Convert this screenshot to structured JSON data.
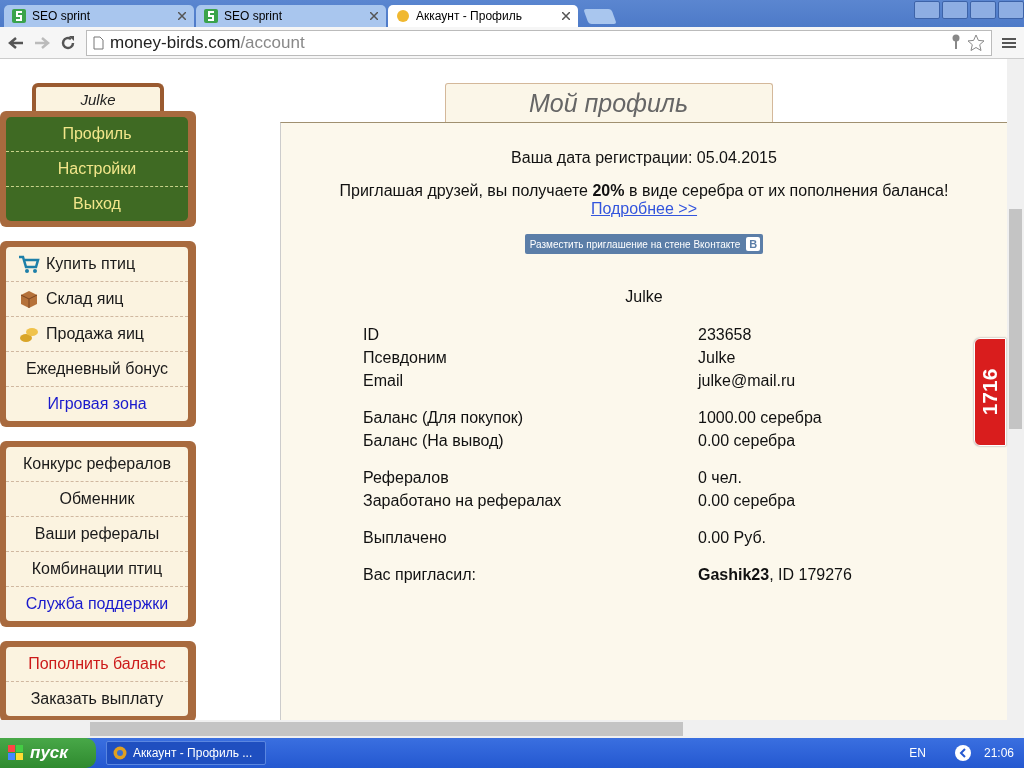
{
  "browser": {
    "tabs": [
      {
        "title": "SEO sprint",
        "selected": false,
        "kind": "seo"
      },
      {
        "title": "SEO sprint",
        "selected": false,
        "kind": "seo"
      },
      {
        "title": "Аккаунт - Профиль",
        "selected": true,
        "kind": "bird"
      }
    ],
    "address": {
      "host": "money-birds.com",
      "path": "/account"
    }
  },
  "sidebar": {
    "user": "Julke",
    "user_menu": [
      {
        "label": "Профиль"
      },
      {
        "label": "Настройки"
      },
      {
        "label": "Выход"
      }
    ],
    "groups": [
      [
        {
          "label": "Купить птиц",
          "kind": "cart",
          "color": "#1a1a1a"
        },
        {
          "label": "Склад яиц",
          "kind": "box",
          "color": "#1a1a1a"
        },
        {
          "label": "Продажа яиц",
          "kind": "coins",
          "color": "#1a1a1a"
        },
        {
          "label": "Ежедневный бонус",
          "color": "#1a1a1a"
        },
        {
          "label": "Игровая зона",
          "color": "#1a1acc"
        }
      ],
      [
        {
          "label": "Конкурс рефералов",
          "color": "#1a1a1a"
        },
        {
          "label": "Обменник",
          "color": "#1a1a1a"
        },
        {
          "label": "Ваши рефералы",
          "color": "#1a1a1a"
        },
        {
          "label": "Комбинации птиц",
          "color": "#1a1a1a"
        },
        {
          "label": "Служба поддержки",
          "color": "#1a1acc"
        }
      ],
      [
        {
          "label": "Пополнить баланс",
          "color": "#cc1a1a"
        },
        {
          "label": "Заказать выплату",
          "color": "#1a1a1a"
        }
      ]
    ]
  },
  "profile": {
    "title": "Мой профиль",
    "registration": "Ваша дата регистрации: 05.04.2015",
    "invite": "Приглашая друзей, вы получаете **20%** в виде серебра от их пополнения баланса!",
    "more_link": "Подробнее >>",
    "vk_button": "Разместить приглашение на стене Вконтакте",
    "vk_letter": "B",
    "username": "Julke",
    "field_groups": [
      [
        {
          "label": "ID",
          "value": "233658"
        },
        {
          "label": "Псевдоним",
          "value": "Julke"
        },
        {
          "label": "Email",
          "value": "julke@mail.ru"
        }
      ],
      [
        {
          "label": "Баланс (Для покупок)",
          "value": "1000.00 серебра"
        },
        {
          "label": "Баланс (На вывод)",
          "value": "0.00 серебра"
        }
      ],
      [
        {
          "label": "Рефералов",
          "value": "0 чел."
        },
        {
          "label": "Заработано на рефералах",
          "value": "0.00 серебра"
        }
      ],
      [
        {
          "label": "Выплачено",
          "value": "0.00 Руб."
        }
      ],
      [
        {
          "label": "Вас пригласил:",
          "value": "**Gashik23**, ID 179276"
        }
      ]
    ]
  },
  "side_badge": "1716",
  "taskbar": {
    "start": "пуск",
    "task": "Аккаунт - Профиль ...",
    "lang": "EN",
    "clock": "21:06"
  }
}
